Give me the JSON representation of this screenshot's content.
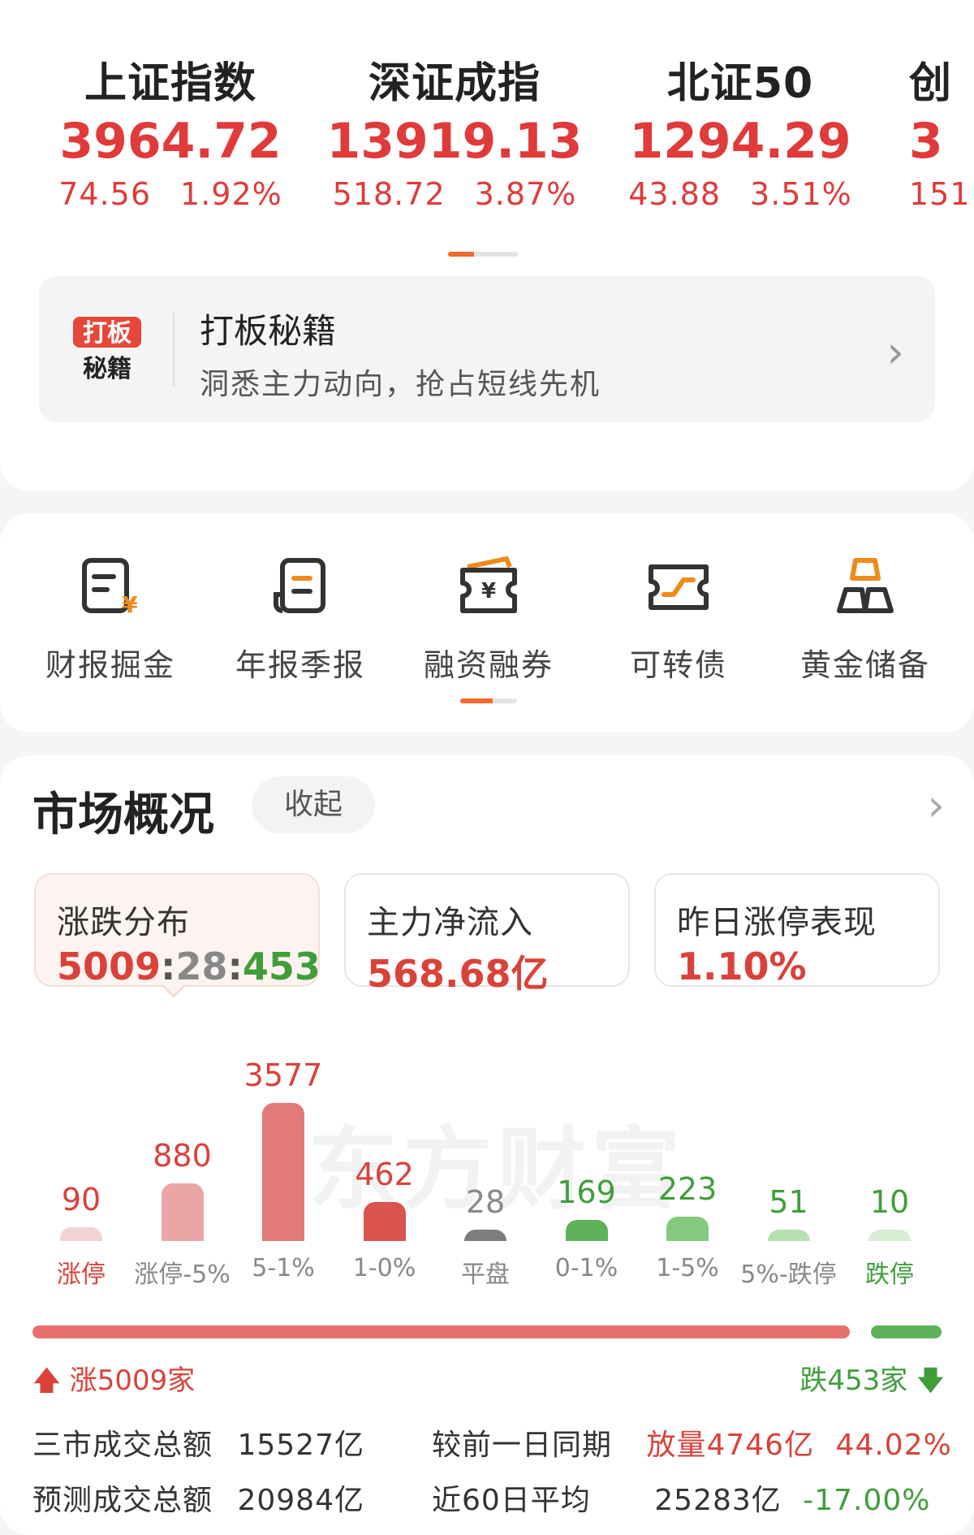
{
  "indices": [
    {
      "name": "上证指数",
      "value": "3964.72",
      "change": "74.56",
      "pct": "1.92%"
    },
    {
      "name": "深证成指",
      "value": "13919.13",
      "change": "518.72",
      "pct": "3.87%"
    },
    {
      "name": "北证50",
      "value": "1294.29",
      "change": "43.88",
      "pct": "3.51%"
    },
    {
      "name": "创",
      "value": "3",
      "change": "151",
      "pct": ""
    }
  ],
  "promo": {
    "logo_line1": "打板",
    "logo_line2": "秘籍",
    "title": "打板秘籍",
    "subtitle": "洞悉主力动向，抢占短线先机"
  },
  "tools": [
    {
      "label": "财报掘金",
      "icon": "report-gold-icon"
    },
    {
      "label": "年报季报",
      "icon": "annual-report-icon"
    },
    {
      "label": "融资融券",
      "icon": "margin-trading-icon"
    },
    {
      "label": "可转债",
      "icon": "convertible-bond-icon"
    },
    {
      "label": "黄金储备",
      "icon": "gold-reserve-icon"
    }
  ],
  "market": {
    "title": "市场概况",
    "collapse_label": "收起",
    "stats": [
      {
        "label": "涨跌分布",
        "up": "5009",
        "flat": "28",
        "down": "453",
        "sep": ":"
      },
      {
        "label": "主力净流入",
        "value": "568.68亿"
      },
      {
        "label": "昨日涨停表现",
        "value": "1.10%"
      }
    ],
    "watermark": "东方财富",
    "up_total": "涨5009家",
    "down_total": "跌453家",
    "up_fraction": 0.9137,
    "down_fraction": 0.0826,
    "rows": [
      {
        "label": "三市成交总额",
        "value": "15527亿",
        "label2": "较前一日同期",
        "value2a": "放量4746亿",
        "value2b": "44.02%"
      },
      {
        "label": "预测成交总额",
        "value": "20984亿",
        "label2": "近60日平均",
        "value2a": "25283亿",
        "value2b": "-17.00%"
      }
    ]
  },
  "chart_data": {
    "type": "bar",
    "categories": [
      "涨停",
      "涨停-5%",
      "5-1%",
      "1-0%",
      "平盘",
      "0-1%",
      "1-5%",
      "5%-跌停",
      "跌停"
    ],
    "values": [
      90,
      880,
      3577,
      462,
      28,
      169,
      223,
      51,
      10
    ],
    "colors": [
      "#f2d3d2",
      "#eba5a5",
      "#e27a77",
      "#d9534f",
      "#7d7d7d",
      "#5fb15a",
      "#83c97e",
      "#b6e0b0",
      "#d6eed2"
    ],
    "label_colors": [
      "#d9423a",
      "#d9423a",
      "#d9423a",
      "#d9423a",
      "#888888",
      "#3f9e3a",
      "#3f9e3a",
      "#3f9e3a",
      "#3f9e3a"
    ],
    "cat_colors": [
      "#d9423a",
      "#888888",
      "#888888",
      "#888888",
      "#888888",
      "#888888",
      "#888888",
      "#888888",
      "#3f9e3a"
    ],
    "title": "",
    "xlabel": "",
    "ylabel": ""
  }
}
